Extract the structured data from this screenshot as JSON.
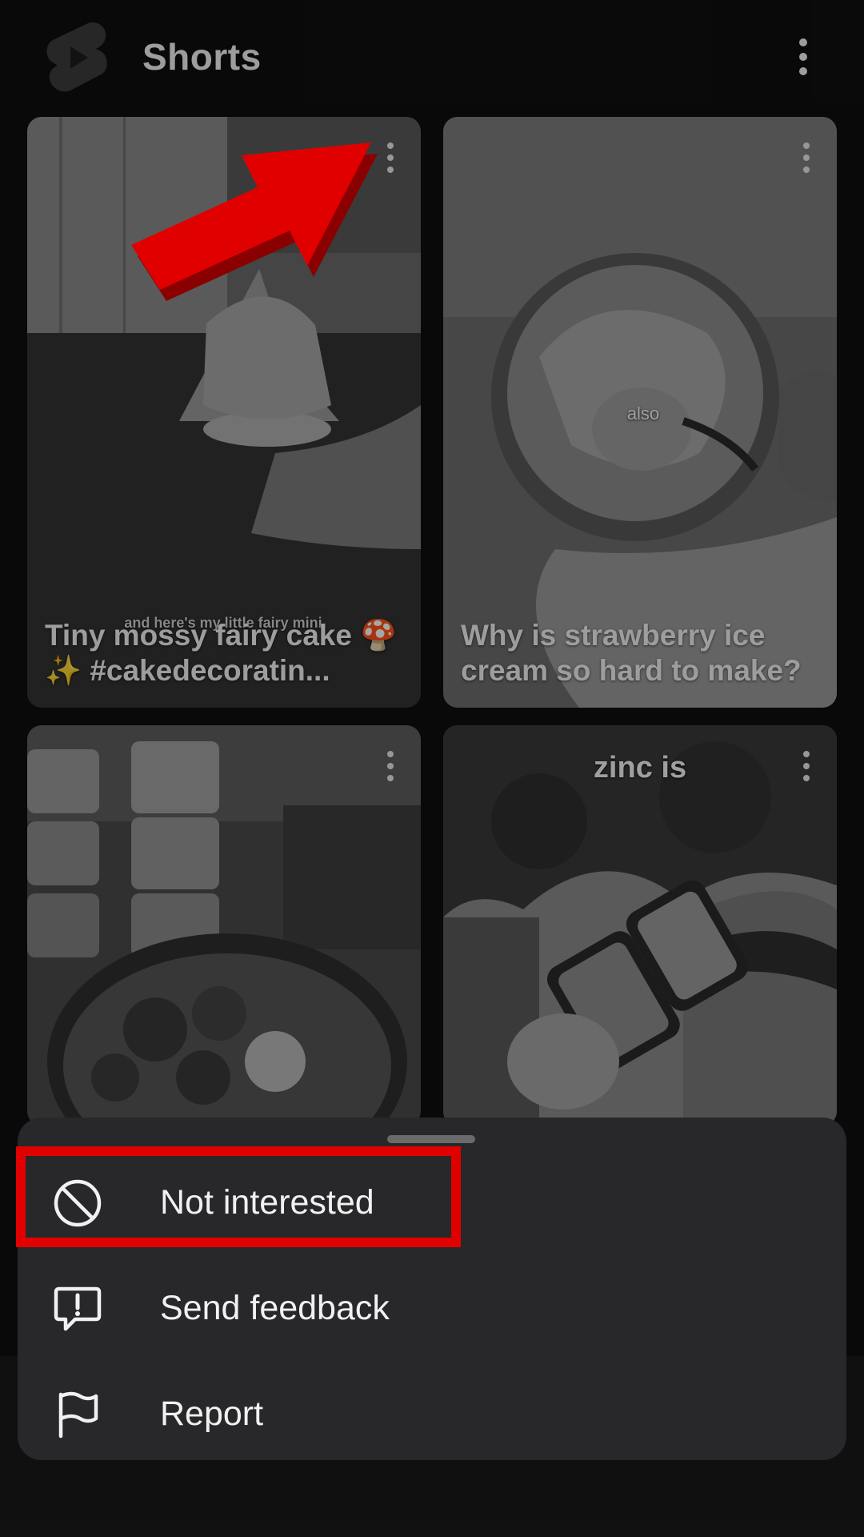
{
  "header": {
    "title": "Shorts",
    "logo_icon": "shorts-logo-icon",
    "menu_icon": "more-vert-icon"
  },
  "cards": [
    {
      "title": "Tiny mossy fairy cake 🍄✨ #cakedecoratin...",
      "overlay_text": "and here's my little fairy mini",
      "menu_icon": "more-vert-icon"
    },
    {
      "title": "Why is strawberry ice cream so hard to make?",
      "overlay_text": "also",
      "menu_icon": "more-vert-icon"
    },
    {
      "title": "",
      "overlay_text": "",
      "menu_icon": "more-vert-icon"
    },
    {
      "title": "",
      "overlay_text": "zinc is",
      "menu_icon": "more-vert-icon"
    }
  ],
  "sheet": {
    "items": [
      {
        "label": "Not interested",
        "icon": "block-icon"
      },
      {
        "label": "Send feedback",
        "icon": "feedback-icon"
      },
      {
        "label": "Report",
        "icon": "flag-icon"
      }
    ]
  },
  "annotations": {
    "highlight_color": "#e10000",
    "arrow_color": "#e10000"
  }
}
